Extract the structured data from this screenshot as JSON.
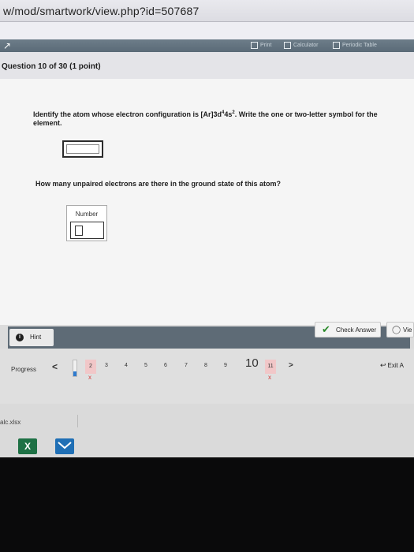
{
  "browser": {
    "url": "w/mod/smartwork/view.php?id=507687"
  },
  "toolbar": {
    "logo": "↗",
    "items": [
      "Print",
      "Calculator",
      "Periodic Table"
    ]
  },
  "question": {
    "header": "Question 10 of 30 (1 point)",
    "prompt1_pre": "Identify the atom whose electron configuration is [Ar]3d",
    "prompt1_sup1": "4",
    "prompt1_mid": "4s",
    "prompt1_sup2": "2",
    "prompt1_post": ". Write the one or two-letter symbol for the element.",
    "prompt2": "How many unpaired electrons are there in the ground state of this atom?",
    "number_label": "Number"
  },
  "actions": {
    "hint": "Hint",
    "check_answer": "Check Answer",
    "view": "Vie"
  },
  "navigation": {
    "progress_label": "Progress",
    "prev": "<",
    "next": ">",
    "exit": "Exit A",
    "progress_fraction": 0.3,
    "questions": [
      {
        "label": "2",
        "status": "wrong"
      },
      {
        "label": "3",
        "status": "normal"
      },
      {
        "label": "4",
        "status": "normal"
      },
      {
        "label": "5",
        "status": "normal"
      },
      {
        "label": "6",
        "status": "normal"
      },
      {
        "label": "7",
        "status": "normal"
      },
      {
        "label": "8",
        "status": "normal"
      },
      {
        "label": "9",
        "status": "normal"
      },
      {
        "label": "10",
        "status": "current"
      },
      {
        "label": "11",
        "status": "wrong"
      }
    ],
    "wrong_mark": "x"
  },
  "downloads": {
    "file": "alc.xlsx"
  },
  "taskbar": {
    "excel_label": "X"
  }
}
